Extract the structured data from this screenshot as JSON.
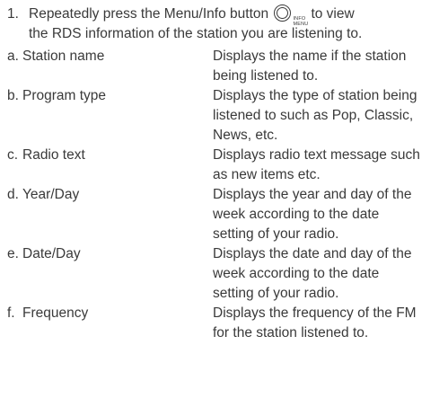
{
  "step": {
    "number": "1.",
    "line1_before": "Repeatedly press the Menu/Info button",
    "button_caption_top": "INFO",
    "button_caption_bottom": "MENU",
    "line1_after": "to view",
    "line2": "the RDS information of the station you are listening to."
  },
  "items": [
    {
      "letter": "a.",
      "label": "Station name",
      "lines": [
        "Displays the name if the station",
        "being listened to."
      ]
    },
    {
      "letter": "b.",
      "label": "Program type",
      "lines": [
        "Displays the type of station being",
        "listened to such as Pop, Classic,",
        "News, etc."
      ]
    },
    {
      "letter": "c.",
      "label": "Radio text",
      "lines": [
        "Displays radio text message such",
        "as new items etc."
      ]
    },
    {
      "letter": "d.",
      "label": "Year/Day",
      "lines": [
        "Displays the year and day of the",
        "week according to the date",
        "setting of your radio."
      ]
    },
    {
      "letter": "e.",
      "label": "Date/Day",
      "lines": [
        "Displays the date and day of the",
        "week according to the date",
        "setting of your radio."
      ]
    },
    {
      "letter": "f.",
      "label": "Frequency",
      "lines": [
        "Displays the frequency of the FM",
        "for the station listened to."
      ]
    }
  ]
}
